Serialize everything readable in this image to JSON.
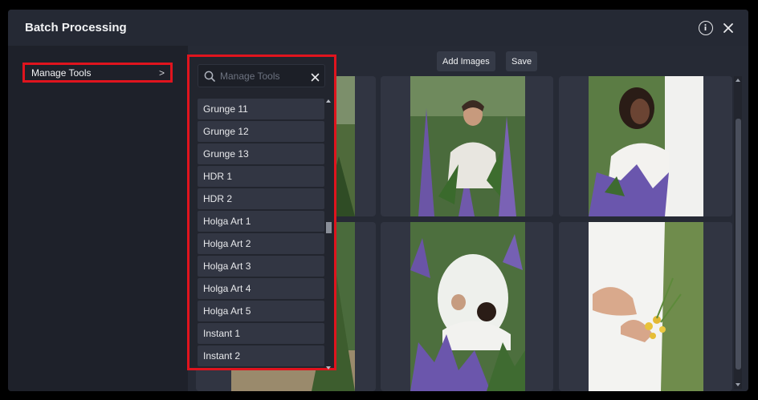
{
  "dialog": {
    "title": "Batch Processing",
    "info_icon": "info-circle-icon",
    "close_icon": "close-icon"
  },
  "sidebar": {
    "items": [
      {
        "label": "Manage Tools",
        "chevron": ">"
      }
    ]
  },
  "toolbar": {
    "add_images_label": "Add Images",
    "save_label": "Save"
  },
  "tools_panel": {
    "search_placeholder": "Manage Tools",
    "search_value": "",
    "items": [
      "Grunge 11",
      "Grunge 12",
      "Grunge 13",
      "HDR 1",
      "HDR 2",
      "Holga Art 1",
      "Holga Art 2",
      "Holga Art 3",
      "Holga Art 4",
      "Holga Art 5",
      "Instant 1",
      "Instant 2"
    ]
  },
  "colors": {
    "highlight": "#e0141e",
    "panel_bg": "#22252e",
    "item_bg": "#323643",
    "dialog_bg": "#1e212a"
  }
}
